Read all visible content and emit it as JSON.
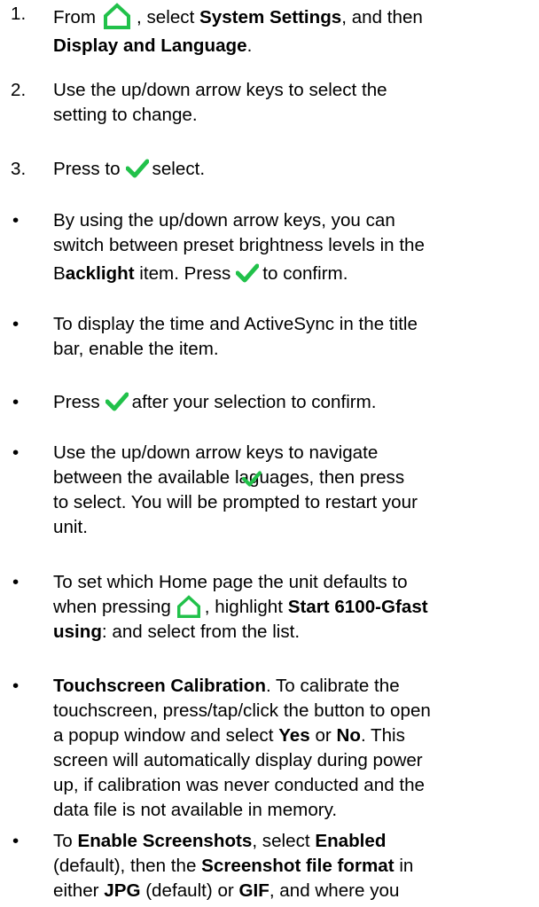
{
  "colors": {
    "icon_green": "#21c14a",
    "text": "#000000",
    "background": "#ffffff"
  },
  "icons": {
    "home": "home-icon",
    "check": "checkmark-icon"
  },
  "steps": [
    {
      "marker": "1.",
      "from": "From",
      "select_prefix": ", select",
      "system_settings": "System Settings",
      "and_then": ", and then",
      "display_language": "Display and Language",
      "period": "."
    },
    {
      "marker": "2.",
      "line1": "Use the up/down arrow keys to select the",
      "line2": "setting to change."
    },
    {
      "marker": "3.",
      "before": "Press to",
      "after": "select."
    }
  ],
  "bullets": [
    {
      "marker": "•",
      "line1": "By using the up/down arrow keys, you can",
      "line2": "switch between preset brightness levels in the",
      "l3_b1": "B",
      "l3_b2": "acklight",
      "l3_mid": " item. Press",
      "l3_end": "to confirm."
    },
    {
      "marker": "•",
      "line1": "To display the time and ActiveSync in the title",
      "line2": "bar, enable the item."
    },
    {
      "marker": "•",
      "before": "Press",
      "after": "after your selection to confirm."
    },
    {
      "marker": "•",
      "line1": "Use the up/down arrow keys to navigate",
      "line2_a": "between the available la",
      "line2_b": "guages, then press",
      "line3": "to select. You will be prompted to restart your",
      "line4": "unit."
    },
    {
      "marker": "•",
      "line1": "To set which Home page the unit defaults to",
      "line2_a": "when pressing",
      "line2_b": ", highlight",
      "line2_bold": "Start 6100-Gfast",
      "line3_bold": "using",
      "line3_rest": ": and select from the list."
    },
    {
      "marker": "•",
      "line1_bold": "Touchscreen Calibration",
      "line1_rest": ". To calibrate the",
      "line2": "touchscreen, press/tap/click the button to open",
      "line3_a": "a popup window and select",
      "line3_yes": "Yes",
      "line3_or": "or",
      "line3_no": "No",
      "line3_end": ". This",
      "line4": "screen will automatically display during power",
      "line5": "up, if calibration was never conducted and the",
      "line6": "data file is not available in memory."
    },
    {
      "marker": "•",
      "l1_a": "To",
      "l1_bold1": "Enable Screenshots",
      "l1_b": ", select",
      "l1_bold2": "Enabled",
      "l2_a": "(default), then the",
      "l2_bold": "Screenshot file format",
      "l2_b": "in",
      "l3_a": "either",
      "l3_jpg": "JPG",
      "l3_b": "(default) or",
      "l3_gif": "GIF",
      "l3_c": ", and where you"
    }
  ]
}
